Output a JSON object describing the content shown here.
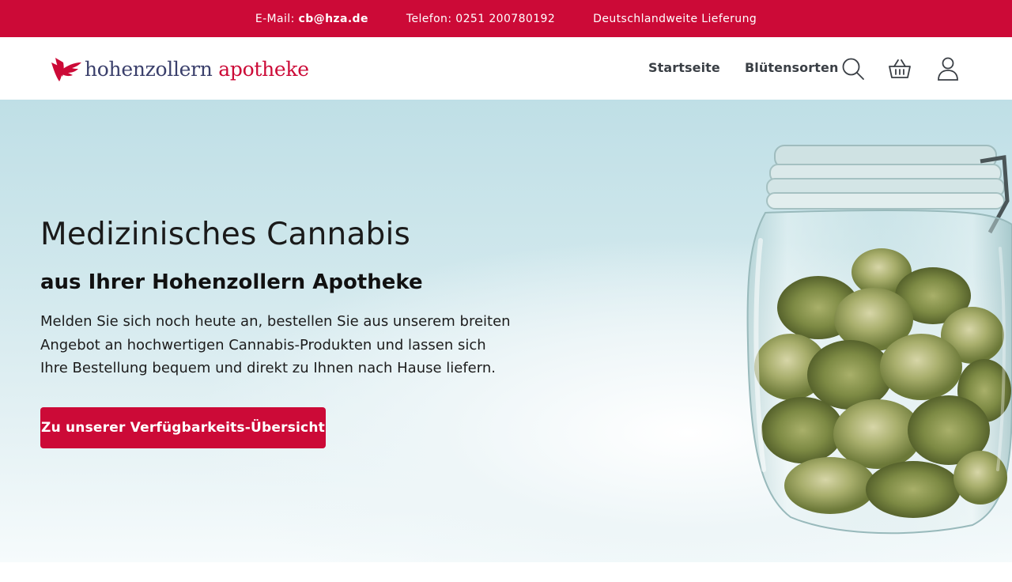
{
  "topbar": {
    "email_label": "E-Mail:",
    "email_value": "cb@hza.de",
    "phone": "Telefon: 0251 200780192",
    "delivery": "Deutschlandweite Lieferung"
  },
  "brand": {
    "name_part1": "hohenzollern",
    "name_part2": "apotheke",
    "accent_color": "#cc0a37",
    "text_color": "#3a3f6b"
  },
  "nav": {
    "items": [
      {
        "label": "Startseite"
      },
      {
        "label": "Blütensorten"
      }
    ],
    "icons": [
      "search-icon",
      "basket-icon",
      "user-icon"
    ]
  },
  "hero": {
    "title": "Medizinisches Cannabis",
    "subtitle": "aus Ihrer Hohenzollern Apotheke",
    "text": "Melden Sie sich noch heute an, bestellen Sie aus unserem breiten Angebot an hochwertigen Cannabis-Produkten und lassen sich Ihre Bestellung bequem und direkt zu Ihnen nach Hause liefern.",
    "cta_label": "Zu unserer Verfügbarkeits-Übersicht"
  }
}
